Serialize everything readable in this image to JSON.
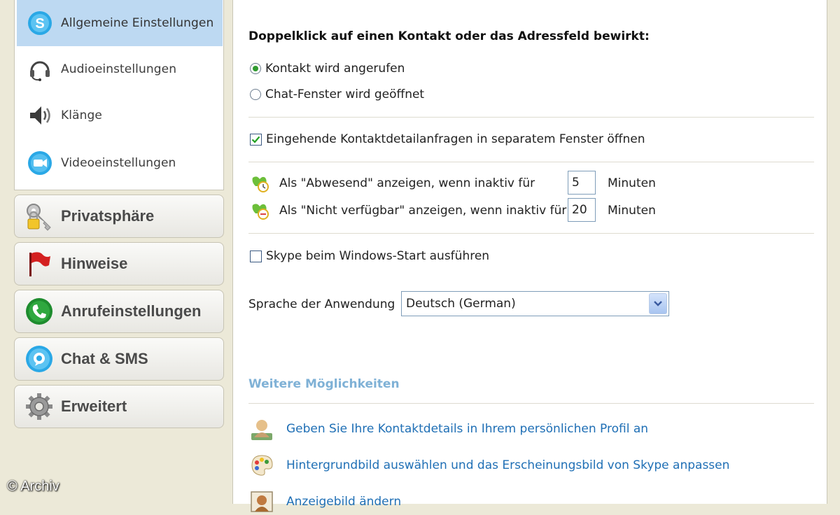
{
  "sidebar": {
    "sub_items": [
      {
        "label": "Allgemeine Einstellungen",
        "icon": "skype-icon",
        "active": true
      },
      {
        "label": "Audioeinstellungen",
        "icon": "headset-icon"
      },
      {
        "label": "Klänge",
        "icon": "speaker-icon"
      },
      {
        "label": "Videoeinstellungen",
        "icon": "video-icon"
      }
    ],
    "categories": [
      {
        "label": "Privatsphäre",
        "icon": "lock-key-icon"
      },
      {
        "label": "Hinweise",
        "icon": "flag-icon"
      },
      {
        "label": "Anrufeinstellungen",
        "icon": "phone-icon"
      },
      {
        "label": "Chat & SMS",
        "icon": "chat-icon"
      },
      {
        "label": "Erweitert",
        "icon": "gear-icon"
      }
    ]
  },
  "main": {
    "doubleclick_heading": "Doppelklick auf einen Kontakt oder das Adressfeld bewirkt:",
    "radio_call": "Kontakt wird angerufen",
    "radio_chat": "Chat-Fenster wird geöffnet",
    "radio_selected": "call",
    "checkbox_contact_requests": {
      "label": "Eingehende Kontaktdetailanfragen in separatem Fenster öffnen",
      "checked": true
    },
    "away": {
      "label": "Als \"Abwesend\" anzeigen, wenn inaktiv für",
      "value": "5",
      "unit": "Minuten"
    },
    "not_available": {
      "label": "Als \"Nicht verfügbar\" anzeigen, wenn inaktiv für",
      "value": "20",
      "unit": "Minuten"
    },
    "checkbox_autostart": {
      "label": "Skype beim Windows-Start ausführen",
      "checked": false
    },
    "language": {
      "label": "Sprache der Anwendung",
      "value": "Deutsch (German)"
    },
    "more_title": "Weitere Möglichkeiten",
    "links": [
      {
        "label": "Geben Sie Ihre Kontaktdetails in Ihrem persönlichen Profil an",
        "icon": "profile-person-icon"
      },
      {
        "label": "Hintergrundbild auswählen und das Erscheinungsbild von Skype anpassen",
        "icon": "palette-icon"
      },
      {
        "label": "Anzeigebild ändern",
        "icon": "picture-icon"
      }
    ]
  },
  "watermark": "© Archiv",
  "colors": {
    "accent_blue": "#1f6fb5",
    "selected_bg": "#bdd9f2",
    "more_title": "#7fb1d6",
    "radio_dot": "#2f9a2f"
  }
}
